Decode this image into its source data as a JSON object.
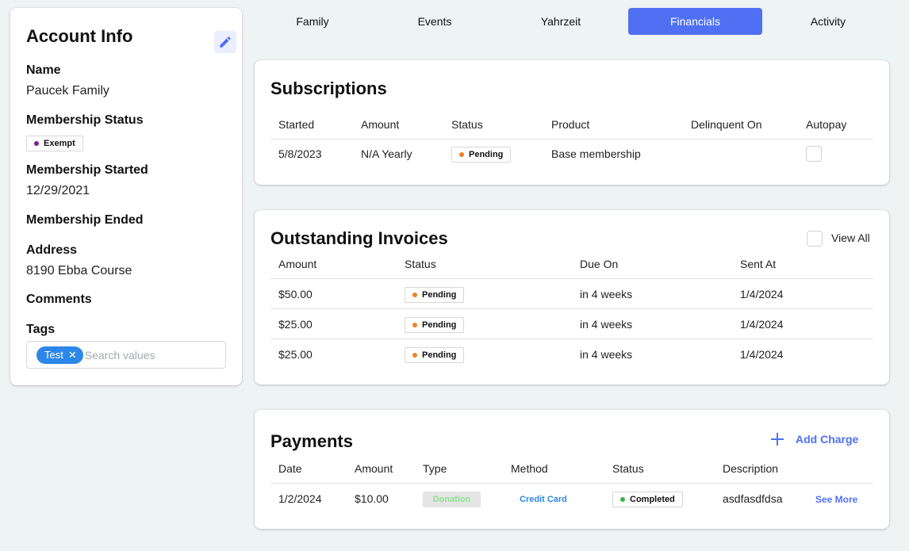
{
  "account": {
    "title": "Account Info",
    "edit_icon": "pencil-icon",
    "fields": {
      "name_label": "Name",
      "name_value": "Paucek Family",
      "status_label": "Membership Status",
      "status_value": "Exempt",
      "status_color": "#8b1a96",
      "started_label": "Membership Started",
      "started_value": "12/29/2021",
      "ended_label": "Membership Ended",
      "address_label": "Address",
      "address_value": "8190 Ebba Course",
      "comments_label": "Comments",
      "tags_label": "Tags"
    },
    "tags": [
      {
        "label": "Test"
      }
    ],
    "tags_placeholder": "Search values"
  },
  "tabs": [
    {
      "label": "Family",
      "active": false
    },
    {
      "label": "Events",
      "active": false
    },
    {
      "label": "Yahrzeit",
      "active": false
    },
    {
      "label": "Financials",
      "active": true
    },
    {
      "label": "Activity",
      "active": false
    }
  ],
  "subscriptions": {
    "title": "Subscriptions",
    "columns": [
      "Started",
      "Amount",
      "Status",
      "Product",
      "Delinquent On",
      "Autopay"
    ],
    "rows": [
      {
        "started": "5/8/2023",
        "amount": "N/A Yearly",
        "status": "Pending",
        "product": "Base membership",
        "delinquent_on": "",
        "autopay": false
      }
    ]
  },
  "invoices": {
    "title": "Outstanding Invoices",
    "view_all_label": "View All",
    "view_all_checked": false,
    "columns": [
      "Amount",
      "Status",
      "Due On",
      "Sent At"
    ],
    "rows": [
      {
        "amount": "$50.00",
        "status": "Pending",
        "due_on": "in 4 weeks",
        "sent_at": "1/4/2024"
      },
      {
        "amount": "$25.00",
        "status": "Pending",
        "due_on": "in 4 weeks",
        "sent_at": "1/4/2024"
      },
      {
        "amount": "$25.00",
        "status": "Pending",
        "due_on": "in 4 weeks",
        "sent_at": "1/4/2024"
      }
    ]
  },
  "payments": {
    "title": "Payments",
    "add_charge_label": "Add Charge",
    "columns": [
      "Date",
      "Amount",
      "Type",
      "Method",
      "Status",
      "Description"
    ],
    "rows": [
      {
        "date": "1/2/2024",
        "amount": "$10.00",
        "type": "Donation",
        "method": "Credit Card",
        "status": "Completed",
        "description": "asdfasdfdsa",
        "see_more": "See More"
      }
    ]
  },
  "colors": {
    "accent": "#5070f3",
    "pending": "#f47f20",
    "completed": "#3cb44b",
    "tag": "#2c87e8"
  }
}
